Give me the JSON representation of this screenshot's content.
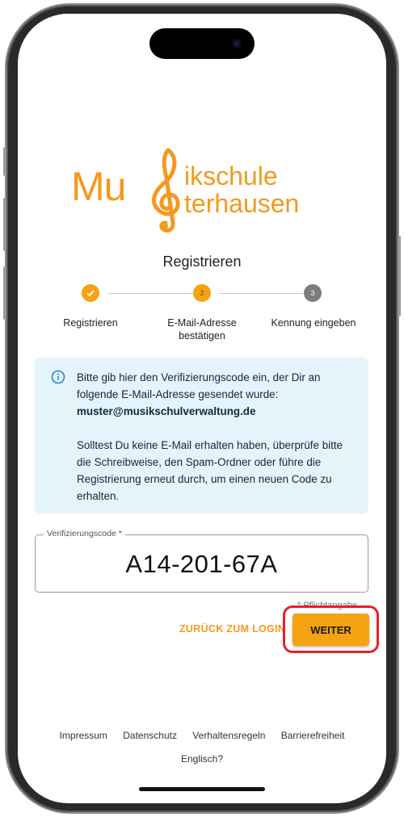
{
  "logo": {
    "line1": "Mu",
    "line2": "ikschule",
    "line3": "terhausen"
  },
  "title": "Registrieren",
  "stepper": {
    "steps": [
      {
        "number": "1",
        "label": "Registrieren",
        "state": "done"
      },
      {
        "number": "2",
        "label": "E-Mail-Adresse bestätigen",
        "state": "active"
      },
      {
        "number": "3",
        "label": "Kennung eingeben",
        "state": "pending"
      }
    ]
  },
  "info": {
    "text1": "Bitte gib hier den Verifizierungscode ein, der Dir an folgende E-Mail-Adresse gesendet wurde:",
    "email": "muster@musikschulverwaltung.de",
    "text2": "Solltest Du keine E-Mail erhalten haben, überprüfe bitte die Schreibweise, den Spam-Ordner oder führe die Registrierung erneut durch, um einen neuen Code zu erhalten."
  },
  "code_field": {
    "label": "Verifizierungscode *",
    "value": "A14-201-67A"
  },
  "required_note": "* Pflichtangabe",
  "buttons": {
    "back": "ZURÜCK ZUM LOGIN",
    "next": "WEITER"
  },
  "footer": {
    "links": [
      "Impressum",
      "Datenschutz",
      "Verhaltensregeln",
      "Barrierefreiheit"
    ],
    "language": "Englisch?"
  },
  "colors": {
    "accent": "#f29a1f",
    "info_bg": "#e5f4fb",
    "highlight": "#e5202a"
  }
}
